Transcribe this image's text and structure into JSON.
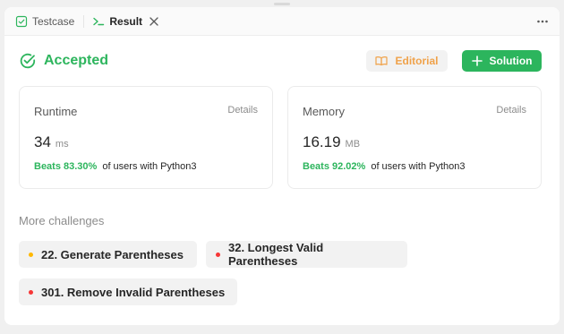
{
  "tabs": {
    "testcase": "Testcase",
    "result": "Result"
  },
  "status": {
    "label": "Accepted",
    "color": "#2db55d"
  },
  "actions": {
    "editorial": "Editorial",
    "solution": "Solution"
  },
  "runtime": {
    "title": "Runtime",
    "details": "Details",
    "value": "34",
    "unit": "ms",
    "beats": "Beats 83.30%",
    "suffix": "of users with Python3"
  },
  "memory": {
    "title": "Memory",
    "details": "Details",
    "value": "16.19",
    "unit": "MB",
    "beats": "Beats 92.02%",
    "suffix": "of users with Python3"
  },
  "challenges": {
    "title": "More challenges",
    "items": [
      {
        "label": "22. Generate Parentheses",
        "difficulty_color": "#ffb800"
      },
      {
        "label": "32. Longest Valid Parentheses",
        "difficulty_color": "#f63636"
      },
      {
        "label": "301. Remove Invalid Parentheses",
        "difficulty_color": "#f63636"
      }
    ]
  },
  "icons": {
    "testcase": "checkbox-icon",
    "result": "terminal-prompt-icon",
    "close": "close-icon",
    "more": "more-horizontal-icon",
    "status": "check-circle-icon",
    "editorial": "book-open-icon",
    "solution": "plus-icon"
  }
}
